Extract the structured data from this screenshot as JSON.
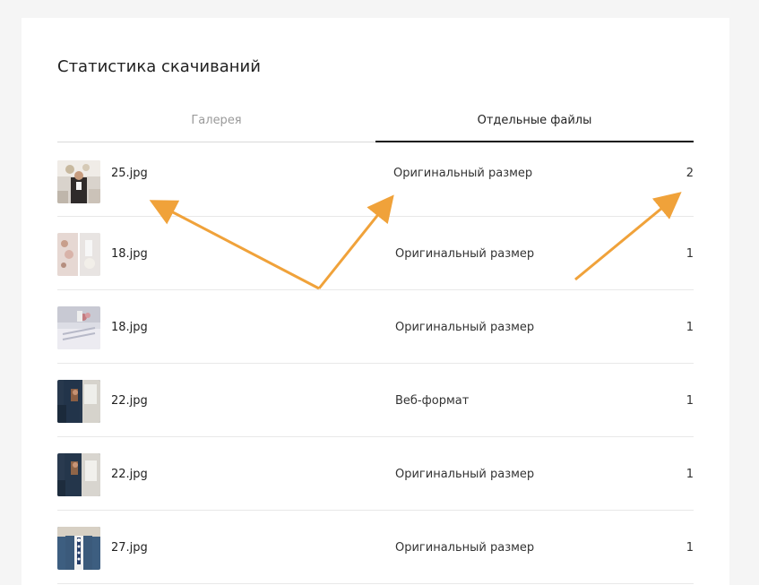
{
  "page": {
    "title": "Статистика скачиваний"
  },
  "tabs": [
    {
      "label": "Галерея",
      "active": false
    },
    {
      "label": "Отдельные файлы",
      "active": true
    }
  ],
  "files": [
    {
      "name": "25.jpg",
      "format": "Оригинальный размер",
      "count": "2"
    },
    {
      "name": "18.jpg",
      "format": "Оригинальный размер",
      "count": "1"
    },
    {
      "name": "18.jpg",
      "format": "Оригинальный размер",
      "count": "1"
    },
    {
      "name": "22.jpg",
      "format": "Веб-формат",
      "count": "1"
    },
    {
      "name": "22.jpg",
      "format": "Оригинальный размер",
      "count": "1"
    },
    {
      "name": "27.jpg",
      "format": "Оригинальный размер",
      "count": "1"
    }
  ],
  "annotations": {
    "arrow_color": "#f0a23a"
  }
}
